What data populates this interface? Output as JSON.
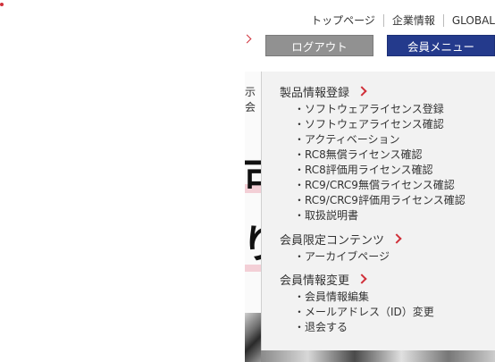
{
  "header": {
    "links": [
      "トップページ",
      "企業情報",
      "GLOBAL"
    ],
    "logout_label": "ログアウト",
    "member_menu_label": "会員メニュー"
  },
  "background": {
    "cut_text": "示会",
    "glyph_1": "可",
    "glyph_2": "り"
  },
  "menu": {
    "sections": [
      {
        "title": "製品情報登録",
        "items": [
          "ソフトウェアライセンス登録",
          "ソフトウェアライセンス確認",
          "アクティベーション",
          "RC8無償ライセンス確認",
          "RC8評価用ライセンス確認",
          "RC9/CRC9無償ライセンス確認",
          "RC9/CRC9評価用ライセンス確認",
          "取扱説明書"
        ]
      },
      {
        "title": "会員限定コンテンツ",
        "items": [
          "アーカイブページ"
        ]
      },
      {
        "title": "会員情報変更",
        "items": [
          "会員情報編集",
          "メールアドレス（ID）変更",
          "退会する"
        ]
      }
    ]
  },
  "colors": {
    "accent_red": "#d0303a",
    "member_button": "#243a8c",
    "logout_button": "#919191",
    "menu_bg": "#f2f2f2"
  }
}
